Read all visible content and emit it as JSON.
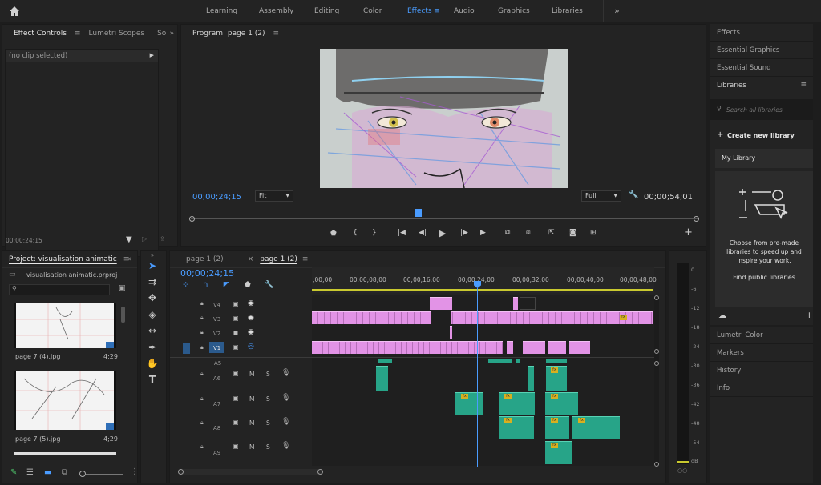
{
  "topbar": {
    "workspaces": [
      "Learning",
      "Assembly",
      "Editing",
      "Color",
      "Effects",
      "Audio",
      "Graphics",
      "Libraries"
    ],
    "active_workspace": "Effects"
  },
  "effect_controls": {
    "tabs": [
      "Effect Controls",
      "Lumetri Scopes",
      "So"
    ],
    "clip_status": "(no clip selected)",
    "timecode": "00;00;24;15"
  },
  "program_monitor": {
    "title": "Program: page 1 (2)",
    "current_timecode": "00;00;24;15",
    "fit_label": "Fit",
    "quality_label": "Full",
    "duration_timecode": "00;00;54;01"
  },
  "project": {
    "title": "Project: visualisation animatic",
    "file_name": "visualisation animatic.prproj",
    "items": [
      {
        "name": "page 7 (4).jpg",
        "duration": "4;29"
      },
      {
        "name": "page 7 (5).jpg",
        "duration": "4;29"
      }
    ]
  },
  "timeline": {
    "tabs": [
      "page 1 (2)",
      "page 1 (2)"
    ],
    "active_tab_index": 1,
    "timecode": "00;00;24;15",
    "ruler_labels": [
      ";00;00",
      "00;00;08;00",
      "00;00;16;00",
      "00;00;24;00",
      "00;00;32;00",
      "00;00;40;00",
      "00;00;48;00"
    ],
    "video_tracks": [
      "V4",
      "V3",
      "V2",
      "V1"
    ],
    "audio_tracks": [
      "A5",
      "A6",
      "A7",
      "A8",
      "A9"
    ],
    "track_buttons": {
      "mute": "M",
      "solo": "S"
    },
    "fx_label": "fx"
  },
  "audio_meter": {
    "labels": [
      "0",
      "-6",
      "-12",
      "-18",
      "-24",
      "-30",
      "-36",
      "-42",
      "-48",
      "-54",
      "dB"
    ]
  },
  "right_panel": {
    "top_items": [
      "Effects",
      "Essential Graphics",
      "Essential Sound"
    ],
    "libraries_title": "Libraries",
    "search_placeholder": "Search all libraries",
    "create_library": "Create new library",
    "my_library": "My Library",
    "promo_text": "Choose from pre-made libraries to speed up and inspire your work.",
    "find_public": "Find public libraries",
    "bottom_items": [
      "Lumetri Color",
      "Markers",
      "History",
      "Info"
    ]
  },
  "colors": {
    "accent": "#4a9cff",
    "video_clip": "#e293e6",
    "audio_clip": "#27a488",
    "playhead": "#4a9cff",
    "fx_badge": "#d6b020"
  }
}
